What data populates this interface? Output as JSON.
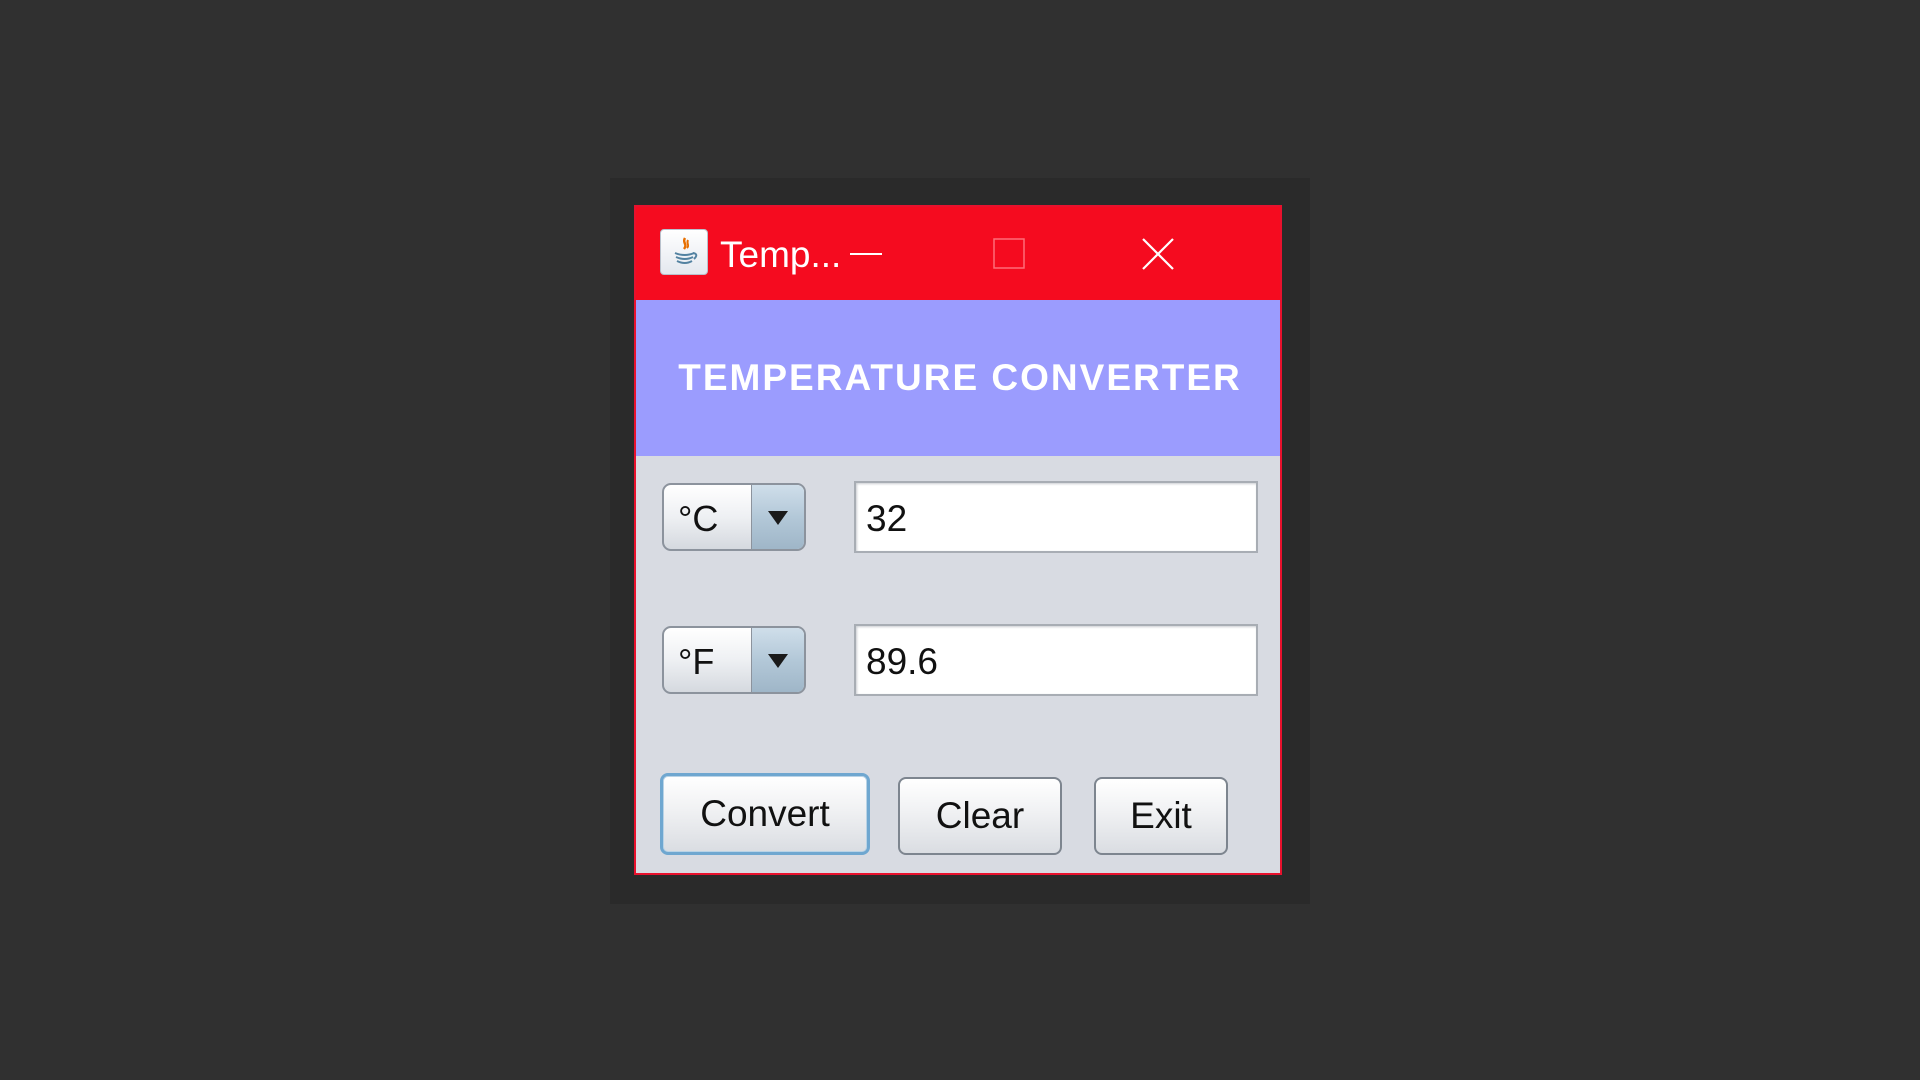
{
  "window": {
    "title": "Temp...",
    "controls": {
      "minimize": "minimize-icon",
      "maximize": "maximize-icon",
      "close": "close-icon"
    },
    "app_icon": "java-icon"
  },
  "header": {
    "title": "TEMPERATURE CONVERTER"
  },
  "rows": [
    {
      "unit": "°C",
      "value": "32"
    },
    {
      "unit": "°F",
      "value": "89.6"
    }
  ],
  "buttons": {
    "convert": "Convert",
    "clear": "Clear",
    "exit": "Exit"
  },
  "colors": {
    "titlebar": "#f50b1f",
    "header": "#9b9cfe",
    "body": "#d8dbe2",
    "desktop": "#303030"
  }
}
